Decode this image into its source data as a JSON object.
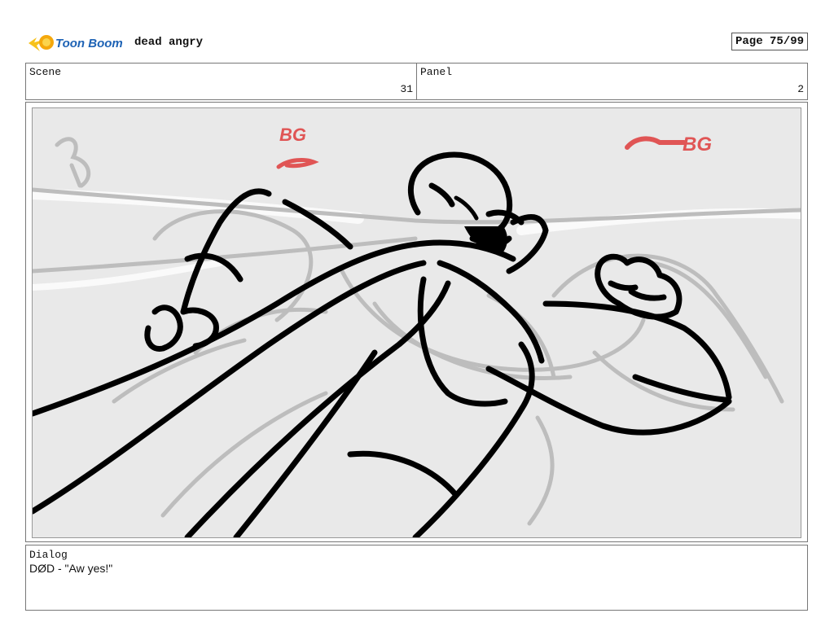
{
  "header": {
    "logo_text": "Toon Boom",
    "project_title": "dead angry",
    "page_label": "Page 75/99"
  },
  "info": {
    "scene_label": "Scene",
    "scene_value": "31",
    "panel_label": "Panel",
    "panel_value": "2"
  },
  "sketch": {
    "annotations": [
      "BG",
      "BG"
    ]
  },
  "dialog": {
    "label": "Dialog",
    "text": "DØD - \"Aw yes!\""
  }
}
